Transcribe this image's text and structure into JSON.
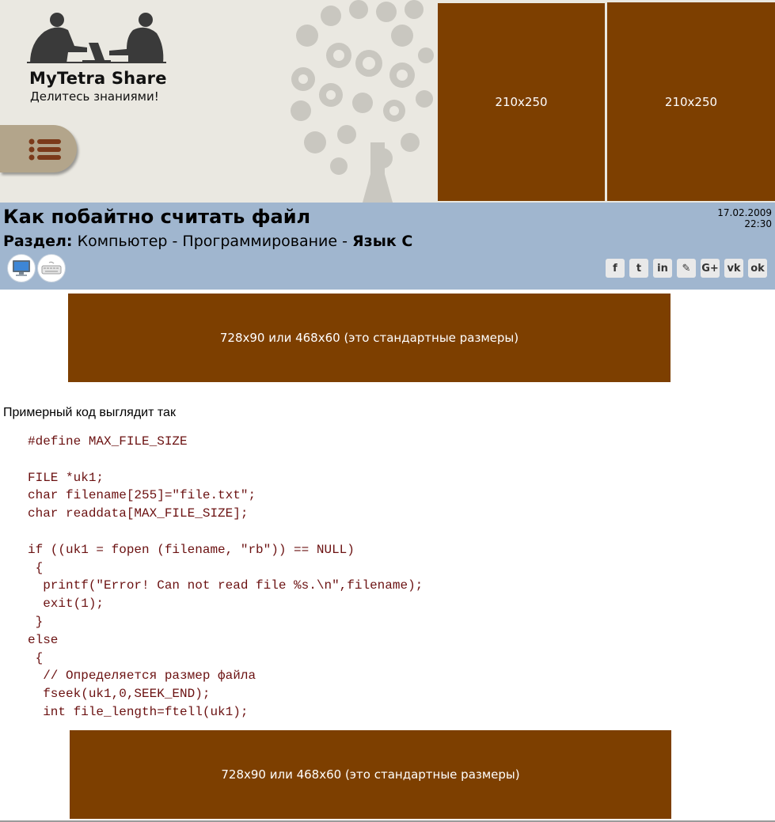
{
  "header": {
    "site_title": "MyTetra Share",
    "site_subtitle": "Делитесь знаниями!",
    "menu_icon": "list-icon",
    "ads": [
      "210x250",
      "210x250"
    ]
  },
  "article": {
    "title": "Как побайтно считать файл",
    "date": "17.02.2009",
    "time": "22:30",
    "section_label": "Раздел:",
    "breadcrumb": [
      "Компьютер",
      "Программирование",
      "Язык С"
    ],
    "breadcrumb_separator": " - ",
    "category_icons": [
      "computer-icon",
      "keyboard-icon"
    ],
    "share_buttons": [
      {
        "name": "facebook",
        "glyph": "f"
      },
      {
        "name": "twitter",
        "glyph": "t"
      },
      {
        "name": "linkedin",
        "glyph": "in"
      },
      {
        "name": "livejournal",
        "glyph": "✎"
      },
      {
        "name": "google-plus",
        "glyph": "G+"
      },
      {
        "name": "vkontakte",
        "glyph": "vk"
      },
      {
        "name": "odnoklassniki",
        "glyph": "ok"
      }
    ]
  },
  "content": {
    "ad_banner_1": "728x90 или 468x60 (это стандартные размеры)",
    "intro": "Примерный код выглядит так",
    "code_lines": [
      "#define MAX_FILE_SIZE",
      "",
      "FILE *uk1;",
      "char filename[255]=\"file.txt\";",
      "char readdata[MAX_FILE_SIZE];",
      "",
      "if ((uk1 = fopen (filename, \"rb\")) == NULL)",
      " {",
      "  printf(\"Error! Can not read file %s.\\n\",filename);",
      "  exit(1);",
      " }",
      "else",
      " {",
      "  // Определяется размер файла",
      "  fseek(uk1,0,SEEK_END);",
      "  int file_length=ftell(uk1);"
    ],
    "ad_banner_2": "728x90 или 468x60 (это стандартные размеры)"
  },
  "colors": {
    "header_bg": "#eae8e1",
    "ad_brown": "#7d3f00",
    "title_band": "#a0b6cf",
    "menu_button": "#b3a58b",
    "code_text": "#6b1111"
  }
}
